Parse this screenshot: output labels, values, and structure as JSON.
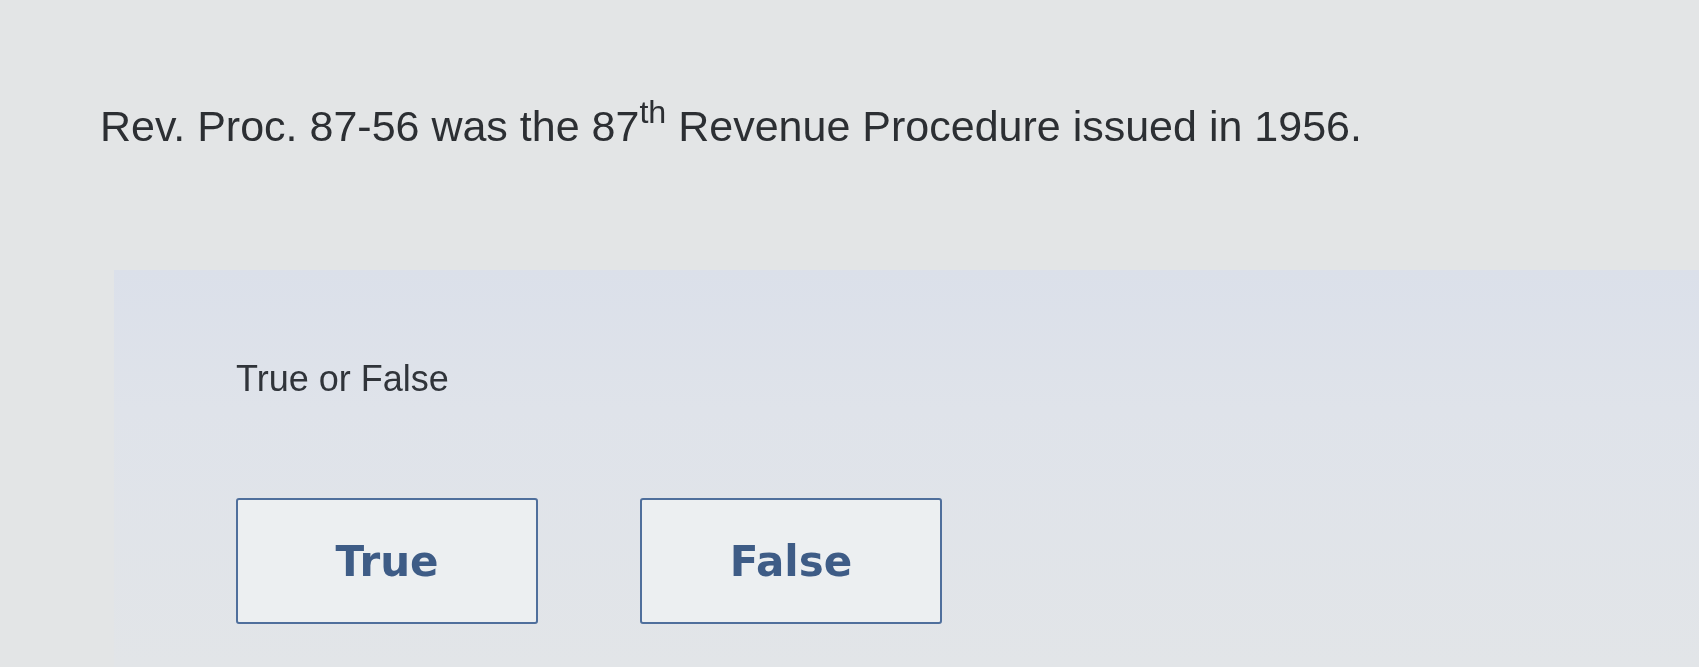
{
  "question": {
    "text": "Rev. Proc. 87-56 was the 87$^{th}$ Revenue Procedure issued in 1956."
  },
  "answer_panel": {
    "prompt": "True or False",
    "options": [
      {
        "label": "True",
        "selected": false
      },
      {
        "label": "False",
        "selected": false
      }
    ]
  }
}
